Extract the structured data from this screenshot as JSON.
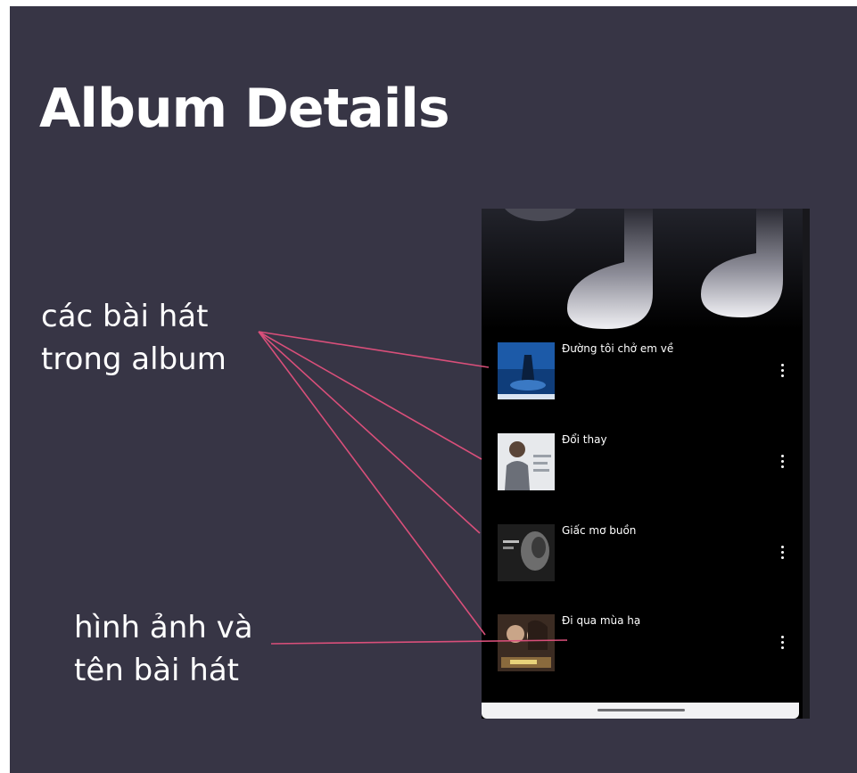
{
  "slide": {
    "title": "Album Details",
    "background": "#373545",
    "accent_line_color": "#d94f7a"
  },
  "annotations": {
    "songs_line1": "các bài hát",
    "songs_line2": "trong album",
    "image_line1": "hình ảnh và",
    "image_line2": "tên bài hát"
  },
  "phone": {
    "header_icon": "music-note-icon",
    "songs": [
      {
        "title": "Đường tôi chở em về",
        "thumb": "blue-album-art"
      },
      {
        "title": "Đổi thay",
        "thumb": "man-portrait-art"
      },
      {
        "title": "Giấc mơ buồn",
        "thumb": "dark-portrait-art"
      },
      {
        "title": "Đi qua mùa hạ",
        "thumb": "couple-portrait-art"
      }
    ],
    "menu_icon": "more-vertical-icon"
  }
}
